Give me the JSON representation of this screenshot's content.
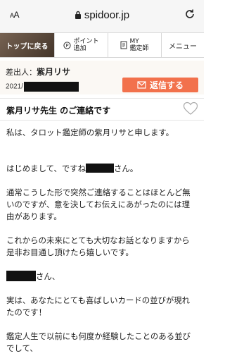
{
  "browser": {
    "text_size_label": "AA",
    "url": "spidoor.jp"
  },
  "nav": {
    "home": "トップに戻る",
    "points_line1": "ポイント",
    "points_line2": "追加",
    "mypage_line1": "MY",
    "mypage_line2": "鑑定師",
    "menu": "メニュー"
  },
  "message": {
    "sender_prefix": "差出人：",
    "sender_name": "紫月リサ",
    "date_prefix": "2021/",
    "reply_label": "返信する",
    "subject": "紫月リサ先生 のご連絡です",
    "p1": "私は、タロット鑑定師の紫月リサと申します。",
    "p2_before": "はじめまして、ですね",
    "p2_after": "さん。",
    "p3": "通常こうした形で突然ご連絡することはほとんど無いのですが、意を決してお伝えにあがったのには理由があります。",
    "p4": "これからの未来にとても大切なお話となりますから是非お目通し頂けたら嬉しいです。",
    "p5_after": "さん、",
    "p6": "実は、あなたにとても喜ばしいカードの並びが現れたのです！",
    "p7": "鑑定人生で以前にも何度か経験したことのある並びでして、"
  },
  "colors": {
    "reply_button": "#f2714c",
    "home_button": "#5a4a3a",
    "sender_background": "#fbf8f4"
  }
}
